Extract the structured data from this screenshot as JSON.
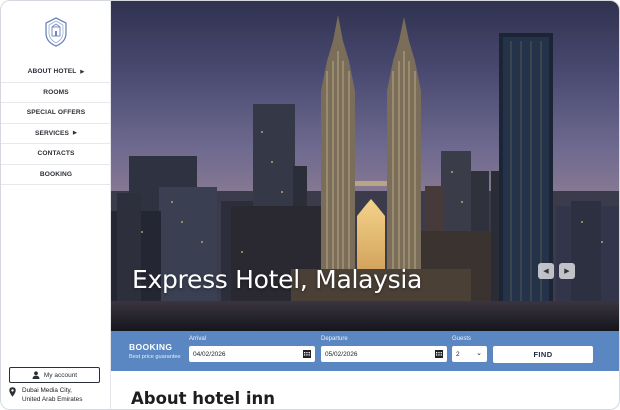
{
  "sidebar": {
    "logo": "hotel-crest-logo",
    "nav": [
      {
        "label": "ABOUT HOTEL",
        "has_submenu": true
      },
      {
        "label": "ROOMS",
        "has_submenu": false
      },
      {
        "label": "SPECIAL OFFERS",
        "has_submenu": false
      },
      {
        "label": "SERVICES",
        "has_submenu": true
      },
      {
        "label": "CONTACTS",
        "has_submenu": false
      },
      {
        "label": "BOOKING",
        "has_submenu": false
      }
    ],
    "account_label": "My account",
    "address_line1": "Dubai Media City,",
    "address_line2": "United Arab Emirates"
  },
  "hero": {
    "title": "Express Hotel, Malaysia",
    "prev_icon": "chevron-left-icon",
    "next_icon": "chevron-right-icon"
  },
  "booking": {
    "label": "BOOKING",
    "subtitle": "Best price guarantee",
    "arrival_label": "Arrival",
    "arrival_value": "04/02/2026",
    "departure_label": "Departure",
    "departure_value": "05/02/2026",
    "guests_label": "Guests",
    "guests_value": "2",
    "find_label": "FIND",
    "accent_color": "#5a86c1"
  },
  "content": {
    "heading": "About hotel inn"
  }
}
